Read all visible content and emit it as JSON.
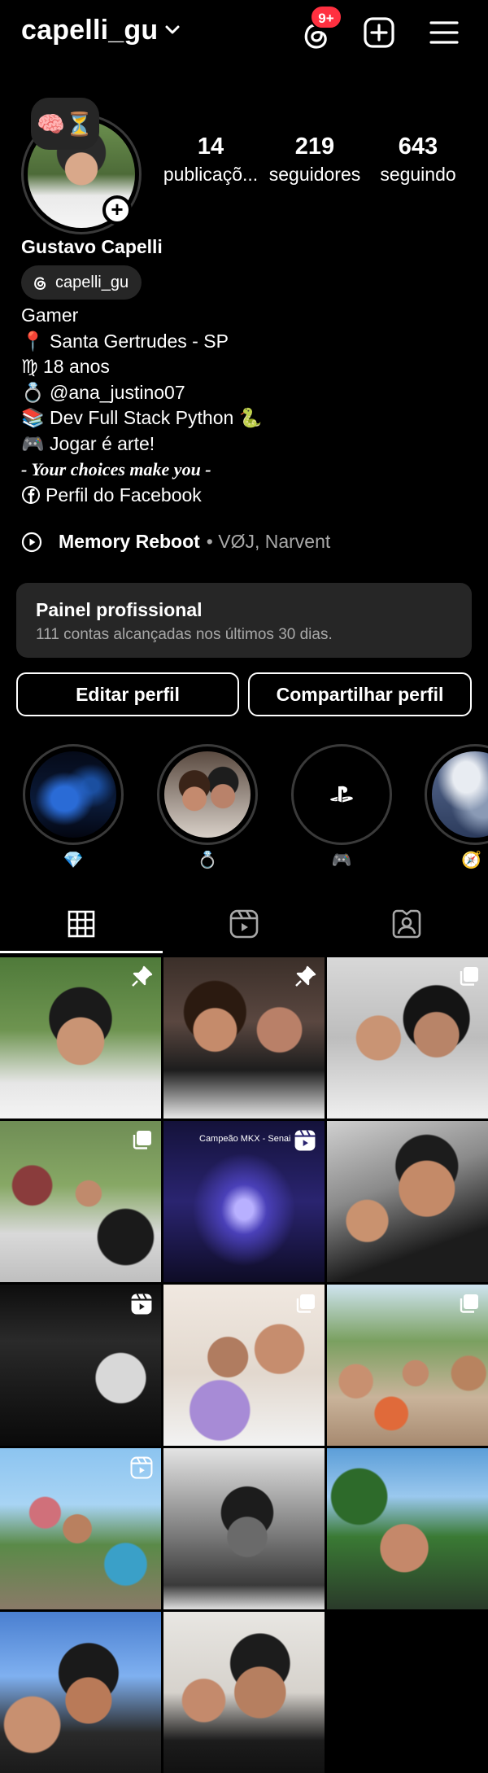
{
  "header": {
    "username": "capelli_gu",
    "notification_badge": "9+"
  },
  "profile": {
    "note": "🧠⏳",
    "stats": [
      {
        "value": "14",
        "label": "publicaçõ..."
      },
      {
        "value": "219",
        "label": "seguidores"
      },
      {
        "value": "643",
        "label": "seguindo"
      }
    ],
    "full_name": "Gustavo Capelli",
    "threads_handle": "capelli_gu",
    "bio_lines": [
      "Gamer",
      "📍 Santa Gertrudes - SP",
      "♍ 18 anos",
      "💍 @ana_justino07",
      "📚 Dev Full Stack Python 🐍",
      "🎮 Jogar é arte!"
    ],
    "bio_quote": "- Your choices make you -",
    "facebook_link": "Perfil do Facebook",
    "music": {
      "song": "Memory Reboot",
      "artists": "• VØJ, Narvent"
    }
  },
  "pro_panel": {
    "title": "Painel profissional",
    "subtitle": "111 contas alcançadas nos últimos 30 dias."
  },
  "actions": {
    "edit": "Editar perfil",
    "share": "Compartilhar perfil"
  },
  "highlights": [
    {
      "label": "💎",
      "cover": "dark room with blue monitor lights"
    },
    {
      "label": "💍",
      "cover": "couple selfie with party hats"
    },
    {
      "label": "🎮",
      "cover": "playstation logo"
    },
    {
      "label": "🧭",
      "cover": "cloudy sky"
    }
  ],
  "tabs": [
    "grid-icon",
    "reels-icon",
    "tagged-icon"
  ],
  "grid_overlay_text": "Campeão MKX - Senai",
  "colors": {
    "background": "#000000",
    "surface": "#262626",
    "badge": "#ff3040",
    "secondary_text": "#a8a8a8"
  }
}
